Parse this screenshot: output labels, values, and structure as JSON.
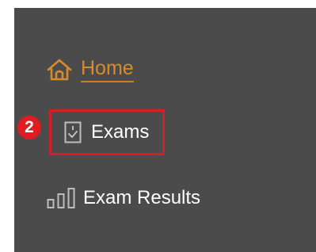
{
  "sidebar": {
    "items": [
      {
        "label": "Home",
        "icon": "home-icon",
        "active": true
      },
      {
        "label": "Exams",
        "icon": "exam-sheet-icon",
        "highlighted": true
      },
      {
        "label": "Exam Results",
        "icon": "bar-chart-icon"
      }
    ]
  },
  "annotation": {
    "step_number": "2"
  },
  "colors": {
    "sidebar_bg": "#4b4b4b",
    "active": "#d98a2b",
    "text": "#ffffff",
    "highlight": "#d51f28"
  }
}
